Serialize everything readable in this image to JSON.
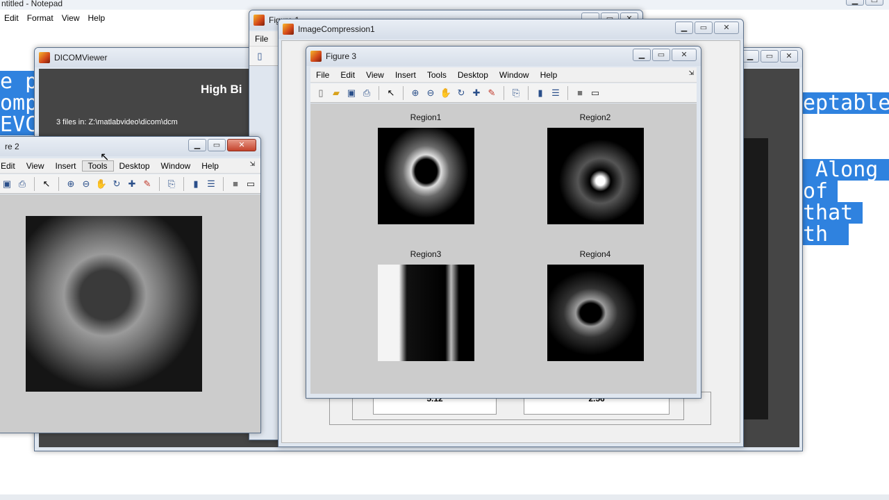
{
  "notepad": {
    "title": "ntitled - Notepad",
    "menu": [
      "Edit",
      "Format",
      "View",
      "Help"
    ]
  },
  "background_doc": {
    "left_lines": [
      "e p",
      "omp",
      "EVC"
    ],
    "right_lines": [
      "eptable",
      " Along",
      "of",
      "that",
      "th"
    ]
  },
  "dicom_viewer": {
    "title": "DICOMViewer",
    "heading": "High Bi",
    "files_info": "3 files in: Z:\\matlabvideo\\dicom\\dcm"
  },
  "figure1": {
    "title": "Figure 1",
    "menu_first": "File"
  },
  "figure2": {
    "title": "re 2",
    "menu": [
      "Edit",
      "View",
      "Insert",
      "Tools",
      "Desktop",
      "Window",
      "Help"
    ]
  },
  "image_compression": {
    "title": "ImageCompression1",
    "values": [
      "5.12",
      "2.56"
    ]
  },
  "figure3": {
    "title": "Figure 3",
    "menu": [
      "File",
      "Edit",
      "View",
      "Insert",
      "Tools",
      "Desktop",
      "Window",
      "Help"
    ],
    "regions": [
      "Region1",
      "Region2",
      "Region3",
      "Region4"
    ]
  },
  "icons": {
    "toolbar": [
      "new-file-icon",
      "open-folder-icon",
      "save-icon",
      "print-icon",
      "pointer-icon",
      "zoom-in-icon",
      "zoom-out-icon",
      "pan-hand-icon",
      "rotate-3d-icon",
      "data-cursor-icon",
      "brush-icon",
      "link-plot-icon",
      "colorbar-icon",
      "legend-icon",
      "hide-tools-icon",
      "show-tools-icon"
    ]
  },
  "colors": {
    "highlight_blue": "#2f82df",
    "figure_bg": "#cccccc",
    "close_red": "#c4432b"
  }
}
